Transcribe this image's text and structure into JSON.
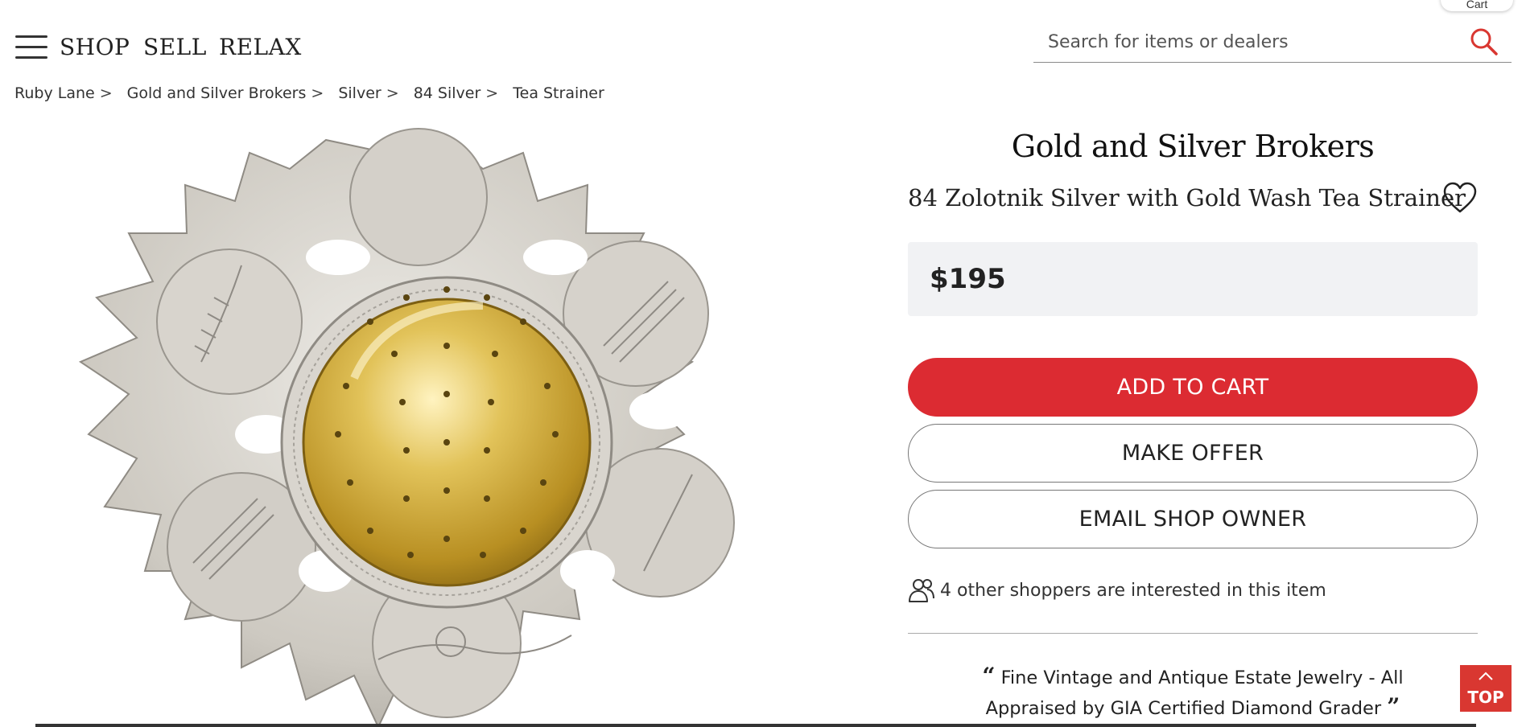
{
  "header": {
    "nav": [
      "SHOP",
      "SELL",
      "RELAX"
    ],
    "cart_label": "Cart",
    "search": {
      "placeholder": "Search for items or dealers"
    }
  },
  "breadcrumb": [
    "Ruby Lane",
    "Gold and Silver Brokers",
    "Silver",
    "84 Silver",
    "Tea Strainer"
  ],
  "breadcrumb_separator": ">",
  "product": {
    "shop_name": "Gold and Silver Brokers",
    "title": "84 Zolotnik Silver with Gold Wash Tea Strainer",
    "price": "$195",
    "add_to_cart_label": "ADD TO CART",
    "make_offer_label": "MAKE OFFER",
    "email_label": "EMAIL SHOP OWNER",
    "shoppers_text": "4 other shoppers are interested in this item",
    "quote_text": "Fine Vintage and Antique Estate Jewelry - All Appraised by GIA Certified Diamond Grader"
  },
  "top_button_label": "TOP",
  "colors": {
    "accent_red": "#dc2b32",
    "price_bg": "#f1f2f4",
    "silver": "#cfccc6",
    "gold": "#d6b94a"
  },
  "icons": [
    "hamburger-menu-icon",
    "search-icon",
    "heart-icon",
    "shoppers-icon",
    "chevron-up-icon"
  ]
}
